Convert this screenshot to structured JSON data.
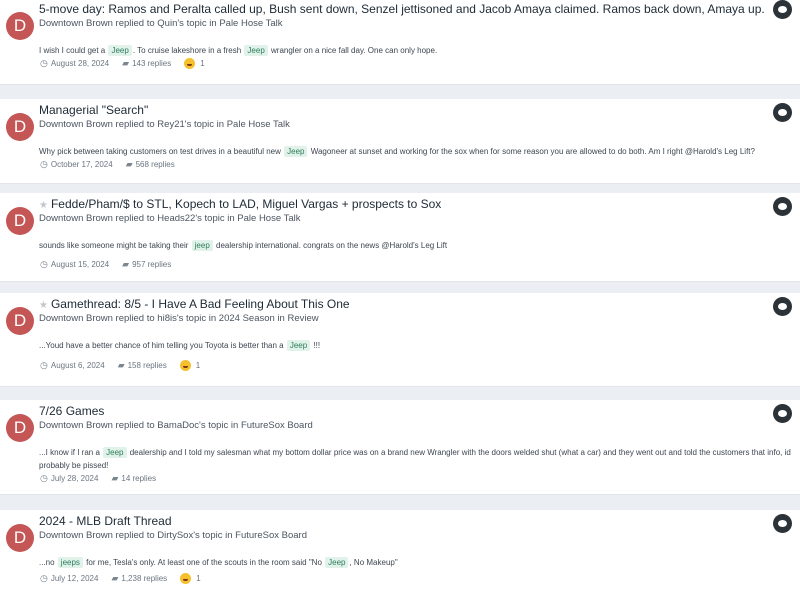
{
  "posts": [
    {
      "title": "5-move day: Ramos and Peralta called up, Bush sent down, Senzel jettisoned and Jacob Amaya claimed. Ramos back down, Amaya up.",
      "starred": false,
      "avatar_letter": "D",
      "author": "Downtown Brown",
      "action": "replied to",
      "topic_owner": "Quin's topic",
      "forum_prefix": "in",
      "forum": "Pale Hose Talk",
      "snippet": [
        "I wish I could get a ",
        {
          "tag": "Jeep"
        },
        ". To cruise lakeshore in a fresh ",
        {
          "tag": "Jeep"
        },
        " wrangler on a nice fall day. One can only hope."
      ],
      "date": "August 28, 2024",
      "replies": "143 replies",
      "reaction_count": "1"
    },
    {
      "title": "Managerial \"Search\"",
      "starred": false,
      "avatar_letter": "D",
      "author": "Downtown Brown",
      "action": "replied to",
      "topic_owner": "Rey21's topic",
      "forum_prefix": "in",
      "forum": "Pale Hose Talk",
      "snippet": [
        "Why pick between taking customers on test drives in a beautiful new ",
        {
          "tag": "Jeep"
        },
        " Wagoneer at sunset and working for the sox when for some reason you are allowed to do both. Am I right @Harold's Leg Lift?"
      ],
      "date": "October 17, 2024",
      "replies": "568 replies",
      "reaction_count": ""
    },
    {
      "title": "Fedde/Pham/$ to STL, Kopech to LAD, Miguel Vargas + prospects to Sox",
      "starred": true,
      "avatar_letter": "D",
      "author": "Downtown Brown",
      "action": "replied to",
      "topic_owner": "Heads22's topic",
      "forum_prefix": "in",
      "forum": "Pale Hose Talk",
      "snippet": [
        "sounds like someone might be taking their ",
        {
          "tag": "jeep"
        },
        " dealership international. congrats on the news @Harold's Leg Lift"
      ],
      "date": "August 15, 2024",
      "replies": "957 replies",
      "reaction_count": ""
    },
    {
      "title": "Gamethread: 8/5 - I Have A Bad Feeling About This One",
      "starred": true,
      "avatar_letter": "D",
      "author": "Downtown Brown",
      "action": "replied to",
      "topic_owner": "hi8is's topic",
      "forum_prefix": "in",
      "forum": "2024 Season in Review",
      "snippet": [
        "...Youd have a better chance of him telling you Toyota is better than a ",
        {
          "tag": "Jeep"
        },
        " !!!"
      ],
      "date": "August 6, 2024",
      "replies": "158 replies",
      "reaction_count": "1"
    },
    {
      "title": "7/26 Games",
      "starred": false,
      "avatar_letter": "D",
      "author": "Downtown Brown",
      "action": "replied to",
      "topic_owner": "BamaDoc's topic",
      "forum_prefix": "in",
      "forum": "FutureSox Board",
      "snippet": [
        "...I know if I ran a ",
        {
          "tag": "Jeep"
        },
        " dealership and I told my salesman what my bottom dollar price was on a brand new Wrangler with the doors welded shut (what a car) and they went out and told the customers that info, id probably be pissed!"
      ],
      "date": "July 28, 2024",
      "replies": "14 replies",
      "reaction_count": ""
    },
    {
      "title": "2024 - MLB Draft Thread",
      "starred": false,
      "avatar_letter": "D",
      "author": "Downtown Brown",
      "action": "replied to",
      "topic_owner": "DirtySox's topic",
      "forum_prefix": "in",
      "forum": "FutureSox Board",
      "snippet": [
        "...no ",
        {
          "tag": "jeeps"
        },
        " for me, Tesla's only. At least one of the scouts in the room said \"No ",
        {
          "tag": "Jeep"
        },
        ", No Makeup\""
      ],
      "date": "July 12, 2024",
      "replies": "1,238 replies",
      "reaction_count": "1"
    }
  ]
}
